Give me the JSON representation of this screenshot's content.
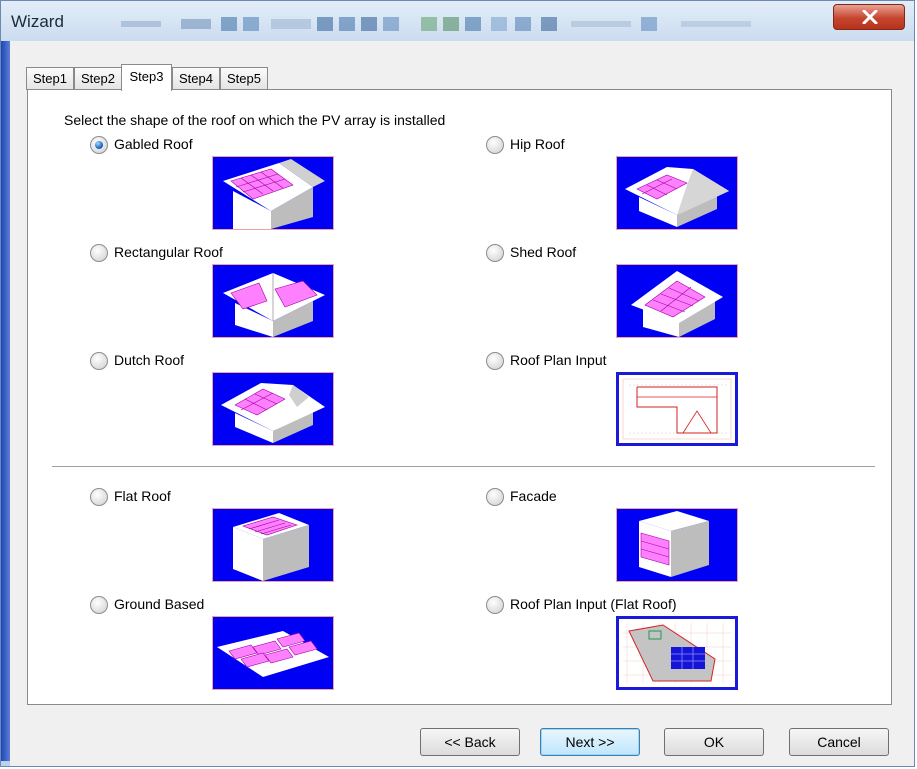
{
  "window": {
    "title": "Wizard",
    "close_glyph": "✕"
  },
  "tabs": [
    {
      "label": "Step1",
      "active": false
    },
    {
      "label": "Step2",
      "active": false
    },
    {
      "label": "Step3",
      "active": true
    },
    {
      "label": "Step4",
      "active": false
    },
    {
      "label": "Step5",
      "active": false
    }
  ],
  "instruction": "Select the shape of the roof on which the PV array is installed",
  "roof_options": [
    {
      "label": "Gabled Roof",
      "selected": true,
      "icon": "gabled-roof-icon"
    },
    {
      "label": "Hip Roof",
      "selected": false,
      "icon": "hip-roof-icon"
    },
    {
      "label": "Rectangular Roof",
      "selected": false,
      "icon": "rectangular-roof-icon"
    },
    {
      "label": "Shed Roof",
      "selected": false,
      "icon": "shed-roof-icon"
    },
    {
      "label": "Dutch Roof",
      "selected": false,
      "icon": "dutch-roof-icon"
    },
    {
      "label": "Roof Plan Input",
      "selected": false,
      "icon": "roof-plan-icon"
    },
    {
      "label": "Flat Roof",
      "selected": false,
      "icon": "flat-roof-icon"
    },
    {
      "label": "Facade",
      "selected": false,
      "icon": "facade-icon"
    },
    {
      "label": "Ground Based",
      "selected": false,
      "icon": "ground-based-icon"
    },
    {
      "label": "Roof Plan Input (Flat Roof)",
      "selected": false,
      "icon": "flat-roof-plan-icon"
    }
  ],
  "buttons": {
    "back": "<< Back",
    "next": ">>",
    "next_prefix": "Next",
    "ok": "OK",
    "cancel": "Cancel"
  },
  "colors": {
    "thumb_background": "#0000f5",
    "panel_color": "#ff80ff",
    "selected_radio": "#1f6cc4",
    "close_button": "#c6452f"
  }
}
